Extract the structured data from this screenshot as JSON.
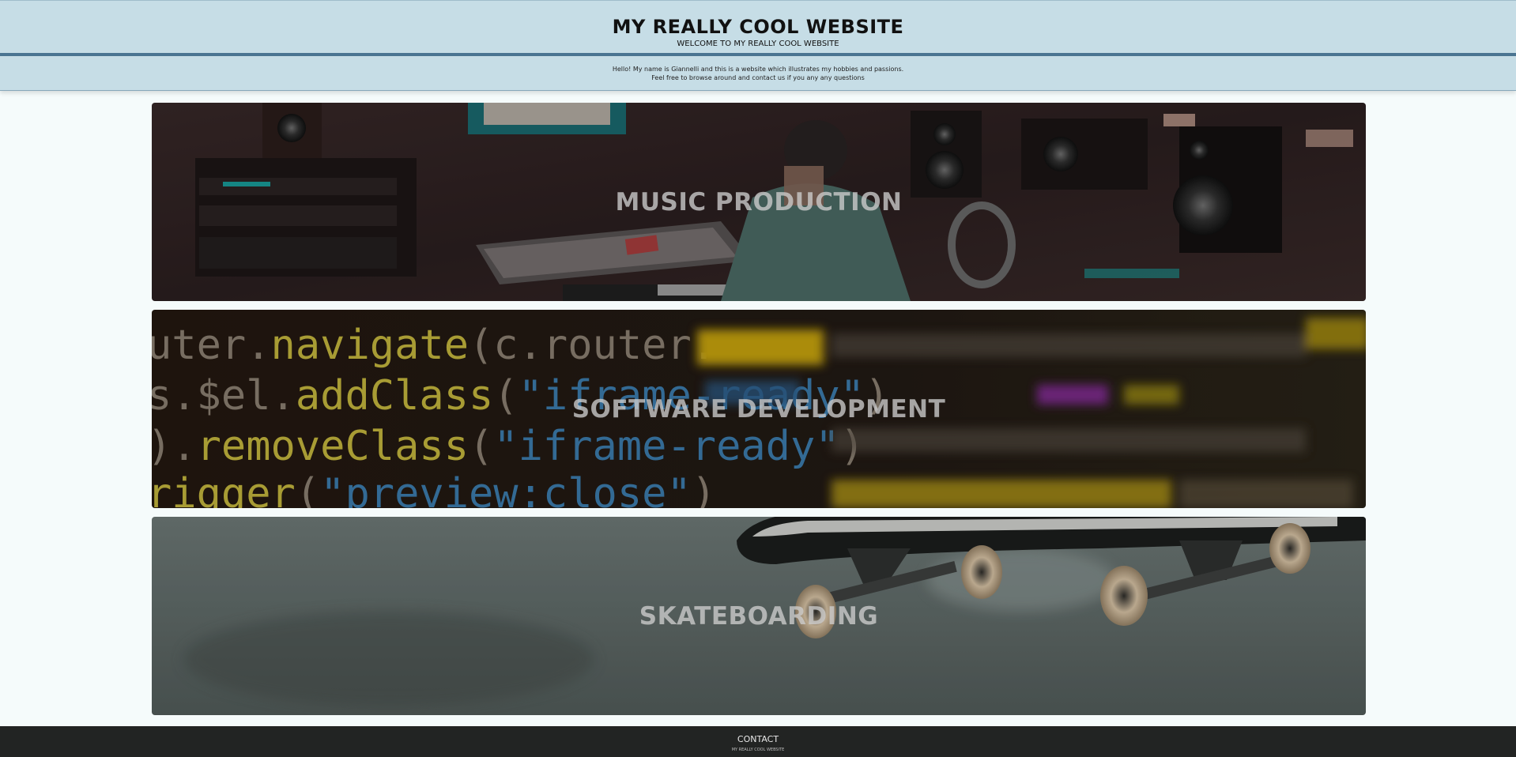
{
  "header": {
    "title": "MY REALLY COOL WEBSITE",
    "subtitle": "WELCOME TO MY REALLY COOL WEBSITE"
  },
  "intro": {
    "line1": "Hello! My name is Giannelli and this is a website which illustrates my hobbies and passions.",
    "line2": "Feel free to browse around and contact us if you any any questions"
  },
  "tiles": [
    {
      "label": "MUSIC PRODUCTION"
    },
    {
      "label": "SOFTWARE DEVELOPMENT"
    },
    {
      "label": "SKATEBOARDING"
    }
  ],
  "code_text": {
    "line1": "uter.navigate(c.router.baseUrl",
    "line2": "s.$el.addClass(\"iframe-ready\")",
    "line3": ").removeClass(\"iframe-ready\")",
    "line4": "rigger(\"preview:close\")"
  },
  "footer": {
    "contact_label": "CONTACT",
    "copyright": "MY REALLY COOL WEBSITE"
  },
  "colors": {
    "header_bg": "#c6dde6",
    "header_border": "#4b7592",
    "page_bg": "#f5fbfb",
    "footer_bg": "#222423"
  }
}
